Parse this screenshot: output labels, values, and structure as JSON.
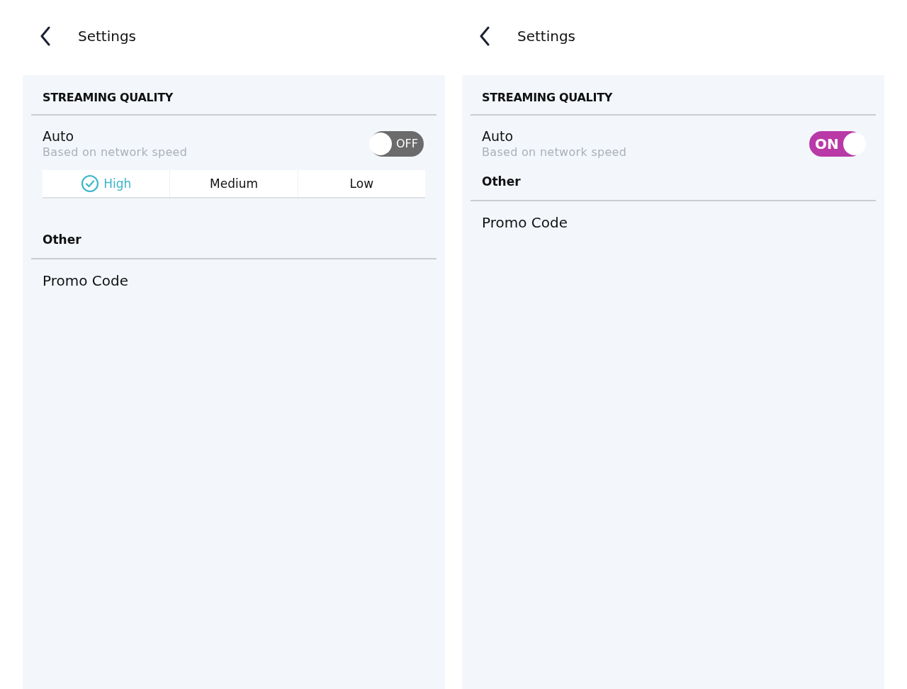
{
  "screens": [
    {
      "header": {
        "title": "Settings"
      },
      "section_title": "STREAMING QUALITY",
      "auto": {
        "label": "Auto",
        "description": "Based on network speed",
        "on": false,
        "toggle_text": "OFF"
      },
      "quality_options": [
        {
          "label": "High",
          "selected": true
        },
        {
          "label": "Medium",
          "selected": false
        },
        {
          "label": "Low",
          "selected": false
        }
      ],
      "other_title": "Other",
      "items": [
        "Promo Code"
      ]
    },
    {
      "header": {
        "title": "Settings"
      },
      "section_title": "STREAMING QUALITY",
      "auto": {
        "label": "Auto",
        "description": "Based on network speed",
        "on": true,
        "toggle_text": "ON"
      },
      "other_title": "Other",
      "items": [
        "Promo Code"
      ]
    }
  ]
}
